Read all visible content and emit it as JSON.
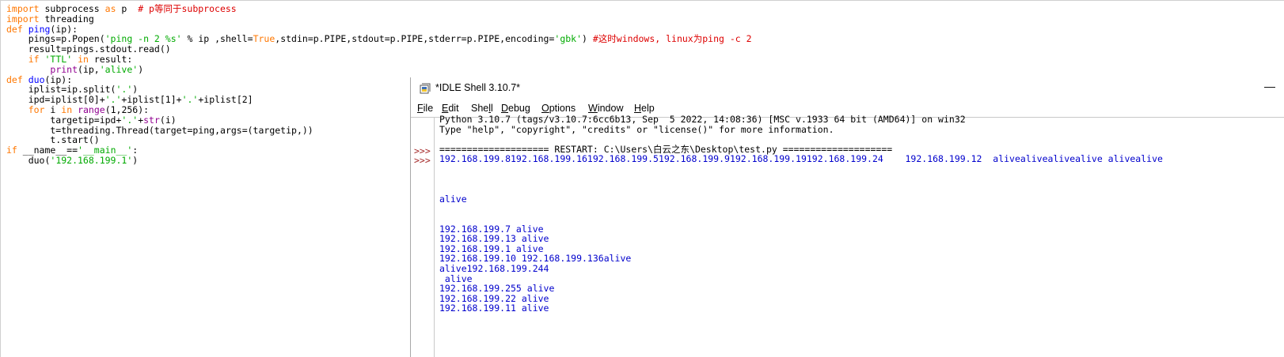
{
  "editor": {
    "code_lines": [
      [
        {
          "t": "import",
          "c": "kw"
        },
        {
          "t": " subprocess "
        },
        {
          "t": "as",
          "c": "kw"
        },
        {
          "t": " p  "
        },
        {
          "t": "# p等同于subprocess",
          "c": "cm"
        }
      ],
      [
        {
          "t": "import",
          "c": "kw"
        },
        {
          "t": " threading"
        }
      ],
      [
        {
          "t": "def",
          "c": "kw"
        },
        {
          "t": " "
        },
        {
          "t": "ping",
          "c": "df"
        },
        {
          "t": "(ip):"
        }
      ],
      [
        {
          "t": "    pings=p.Popen("
        },
        {
          "t": "'ping -n 2 %s'",
          "c": "st"
        },
        {
          "t": " % ip ,shell="
        },
        {
          "t": "True",
          "c": "kw"
        },
        {
          "t": ",stdin=p.PIPE,stdout=p.PIPE,stderr=p.PIPE,encoding="
        },
        {
          "t": "'gbk'",
          "c": "st"
        },
        {
          "t": ") "
        },
        {
          "t": "#这时windows, linux为ping -c 2",
          "c": "cm"
        }
      ],
      [
        {
          "t": "    result=pings.stdout.read()"
        }
      ],
      [
        {
          "t": "    "
        },
        {
          "t": "if",
          "c": "kw"
        },
        {
          "t": " "
        },
        {
          "t": "'TTL'",
          "c": "st"
        },
        {
          "t": " "
        },
        {
          "t": "in",
          "c": "kw"
        },
        {
          "t": " result:"
        }
      ],
      [
        {
          "t": "        "
        },
        {
          "t": "print",
          "c": "bi"
        },
        {
          "t": "(ip,"
        },
        {
          "t": "'alive'",
          "c": "st"
        },
        {
          "t": ")"
        }
      ],
      [
        {
          "t": "def",
          "c": "kw"
        },
        {
          "t": " "
        },
        {
          "t": "duo",
          "c": "df"
        },
        {
          "t": "(ip):"
        }
      ],
      [
        {
          "t": "    iplist=ip.split("
        },
        {
          "t": "'.'",
          "c": "st"
        },
        {
          "t": ")"
        }
      ],
      [
        {
          "t": "    ipd=iplist[0]+"
        },
        {
          "t": "'.'",
          "c": "st"
        },
        {
          "t": "+iplist[1]+"
        },
        {
          "t": "'.'",
          "c": "st"
        },
        {
          "t": "+iplist[2]"
        }
      ],
      [
        {
          "t": "    "
        },
        {
          "t": "for",
          "c": "kw"
        },
        {
          "t": " i "
        },
        {
          "t": "in",
          "c": "kw"
        },
        {
          "t": " "
        },
        {
          "t": "range",
          "c": "bi"
        },
        {
          "t": "(1,256):"
        }
      ],
      [
        {
          "t": "        targetip=ipd+"
        },
        {
          "t": "'.'",
          "c": "st"
        },
        {
          "t": "+"
        },
        {
          "t": "str",
          "c": "bi"
        },
        {
          "t": "(i)"
        }
      ],
      [
        {
          "t": "        t=threading.Thread(target=ping,args=(targetip,))"
        }
      ],
      [
        {
          "t": "        t.start()"
        }
      ],
      [
        {
          "t": "if",
          "c": "kw"
        },
        {
          "t": " __name__=="
        },
        {
          "t": "'__main__'",
          "c": "st"
        },
        {
          "t": ":"
        }
      ],
      [
        {
          "t": "    duo("
        },
        {
          "t": "'192.168.199.1'",
          "c": "st"
        },
        {
          "t": ")"
        }
      ]
    ]
  },
  "shell": {
    "title": "*IDLE Shell 3.10.7*",
    "minimize_glyph": "—",
    "menu": [
      {
        "label": "File",
        "acc": "F",
        "rest": "ile"
      },
      {
        "label": "Edit",
        "acc": "E",
        "rest": "dit"
      },
      {
        "label": "Shell",
        "pre": "She",
        "acc": "l",
        "rest": "l"
      },
      {
        "label": "Debug",
        "acc": "D",
        "rest": "ebug"
      },
      {
        "label": "Options",
        "acc": "O",
        "rest": "ptions"
      },
      {
        "label": "Window",
        "acc": "W",
        "rest": "indow"
      },
      {
        "label": "Help",
        "acc": "H",
        "rest": "elp"
      }
    ],
    "prompt": ">>>",
    "lines": [
      {
        "t": "Python 3.10.7 (tags/v3.10.7:6cc6b13, Sep  5 2022, 14:08:36) [MSC v.1933 64 bit (AMD64)] on win32",
        "c": ""
      },
      {
        "t": "Type \"help\", \"copyright\", \"credits\" or \"license()\" for more information.",
        "c": ""
      },
      {
        "t": "",
        "c": ""
      },
      {
        "t": "==================== RESTART: C:\\Users\\白云之东\\Desktop\\test.py ====================",
        "c": ""
      },
      {
        "t": "192.168.199.8192.168.199.16192.168.199.5192.168.199.9192.168.199.19192.168.199.24    192.168.199.12  alivealivealivealive alivealive",
        "c": "out"
      },
      {
        "t": "",
        "c": "out"
      },
      {
        "t": "",
        "c": "out"
      },
      {
        "t": "",
        "c": "out"
      },
      {
        "t": "alive",
        "c": "out"
      },
      {
        "t": "",
        "c": "out"
      },
      {
        "t": "",
        "c": "out"
      },
      {
        "t": "192.168.199.7 alive",
        "c": "out"
      },
      {
        "t": "192.168.199.13 alive",
        "c": "out"
      },
      {
        "t": "192.168.199.1 alive",
        "c": "out"
      },
      {
        "t": "192.168.199.10 192.168.199.136alive",
        "c": "out"
      },
      {
        "t": "alive192.168.199.244",
        "c": "out"
      },
      {
        "t": " alive",
        "c": "out"
      },
      {
        "t": "192.168.199.255 alive",
        "c": "out"
      },
      {
        "t": "192.168.199.22 alive",
        "c": "out"
      },
      {
        "t": "192.168.199.11 alive",
        "c": "out"
      }
    ],
    "prompt_lines": [
      3,
      4
    ]
  }
}
